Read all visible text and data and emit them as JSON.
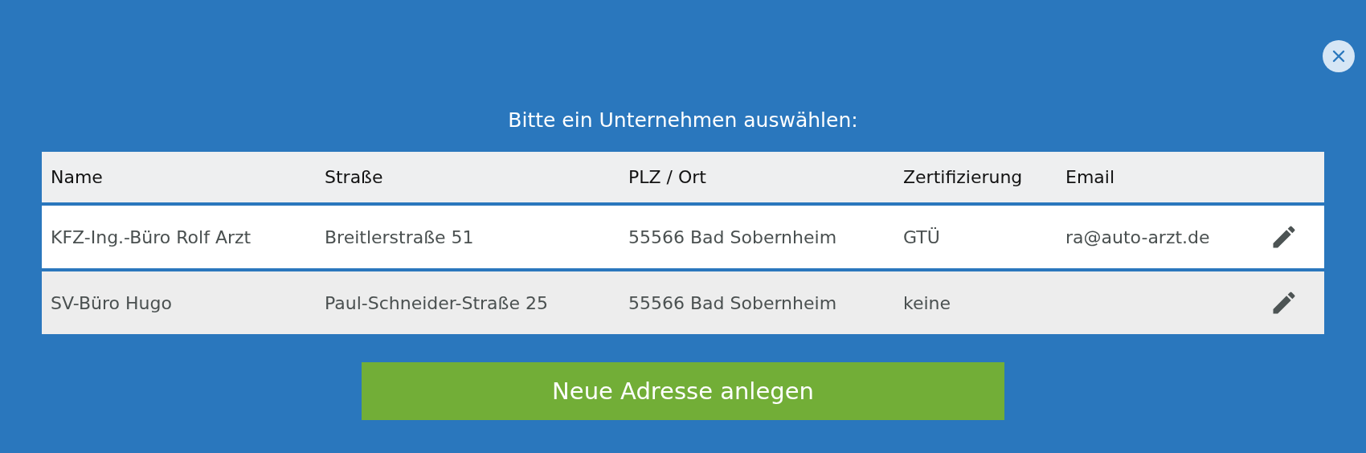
{
  "dialog": {
    "title": "Bitte ein Unternehmen auswählen:"
  },
  "table": {
    "columns": [
      "Name",
      "Straße",
      "PLZ / Ort",
      "Zertifizierung",
      "Email"
    ],
    "rows": [
      {
        "cells": [
          "KFZ-Ing.-Büro Rolf Arzt",
          "Breitlerstraße 51",
          "55566 Bad Sobernheim",
          "GTÜ",
          "ra@auto-arzt.de"
        ],
        "selected": true
      },
      {
        "cells": [
          "SV-Büro Hugo",
          "Paul-Schneider-Straße 25",
          "55566 Bad Sobernheim",
          "keine",
          ""
        ],
        "selected": false
      }
    ]
  },
  "buttons": [
    "Neue Adresse anlegen"
  ]
}
